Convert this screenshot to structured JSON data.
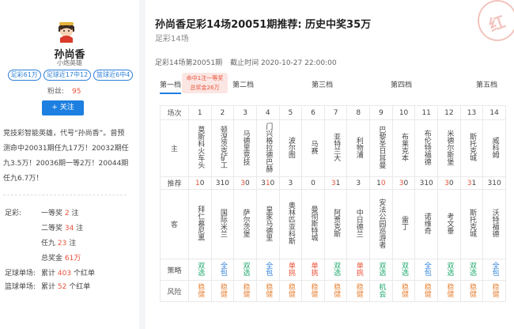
{
  "profile": {
    "name": "孙尚香",
    "title": "小炮英雄",
    "tags": [
      "足彩61万",
      "足球近17中12",
      "篮球近6中4"
    ],
    "fans_label": "粉丝:",
    "fans_count": "95",
    "follow_label": "+ 关注",
    "intro": "竞技彩智能英雄，代号“孙尚香”。曾预测命中20031期任九17万！20032期任九3.5万！20036期一等2万！20044期任九6.7万！",
    "stats": {
      "zucai_label": "足彩:",
      "first_label": "一等奖",
      "first_value": "2",
      "first_unit": "注",
      "second_label": "二等奖",
      "second_value": "34",
      "second_unit": "注",
      "renjiu_label": "任九",
      "renjiu_value": "23",
      "renjiu_unit": "注",
      "total_label": "总奖金",
      "total_value": "61万",
      "football_label": "足球单场:",
      "football_prefix": "累计",
      "football_value": "403",
      "football_suffix": "个红单",
      "basketball_label": "篮球单场:",
      "basketball_prefix": "累计",
      "basketball_value": "52",
      "basketball_suffix": "个红单"
    }
  },
  "main": {
    "title": "孙尚香足彩14场20051期推荐: 历史中奖35万",
    "subtitle": "足彩14场",
    "stamp": "红",
    "issue": "足彩14场第20051期",
    "deadline": "截止时间 2020-10-27 22:00:00",
    "tabs": [
      "第一档",
      "第二档",
      "第三档",
      "第四档",
      "第五档"
    ],
    "tab_badge_line1": "命中1注一等奖",
    "tab_badge_line2": "总奖金26万",
    "row_labels": {
      "match": "场次",
      "home": "主",
      "rec": "推荐",
      "away": "客",
      "strategy": "策略",
      "risk": "风险"
    },
    "matches": [
      {
        "n": "1",
        "home": "莫斯科火车头",
        "rec": "10",
        "rec_pick": "1",
        "away": "拜仁慕尼黑",
        "strategy": "双选",
        "strategy_color": "green",
        "risk": "稳健"
      },
      {
        "n": "2",
        "home": "顿涅茨克矿工",
        "rec": "310",
        "rec_pick": "310",
        "away": "国际米兰",
        "strategy": "全包",
        "strategy_color": "blue",
        "risk": "稳健"
      },
      {
        "n": "3",
        "home": "马德里竞技",
        "rec": "30",
        "rec_pick": "3",
        "away": "萨尔茨堡",
        "strategy": "双选",
        "strategy_color": "green",
        "risk": "稳健"
      },
      {
        "n": "4",
        "home": "门兴格拉德巴赫",
        "rec": "310",
        "rec_pick": "1",
        "away": "皇家马德里",
        "strategy": "全包",
        "strategy_color": "blue",
        "risk": "稳健"
      },
      {
        "n": "5",
        "home": "波尔图",
        "rec": "3",
        "rec_pick": "3",
        "away": "奥林匹亚科斯",
        "strategy": "单挑",
        "strategy_color": "red",
        "risk": "稳健"
      },
      {
        "n": "6",
        "home": "马赛",
        "rec": "0",
        "rec_pick": "0",
        "away": "曼彻斯特城",
        "strategy": "单挑",
        "strategy_color": "red",
        "risk": "稳健"
      },
      {
        "n": "7",
        "home": "亚特兰大",
        "rec": "31",
        "rec_pick": "3",
        "away": "阿贾克斯",
        "strategy": "双选",
        "strategy_color": "green",
        "risk": "稳健"
      },
      {
        "n": "8",
        "home": "利物浦",
        "rec": "3",
        "rec_pick": "3",
        "away": "中日德兰",
        "strategy": "单挑",
        "strategy_color": "red",
        "risk": "稳健"
      },
      {
        "n": "9",
        "home": "巴黎圣日耳曼",
        "rec": "10",
        "rec_pick": "0",
        "away": "安法公园巡游者",
        "strategy": "双选",
        "strategy_color": "green",
        "risk": "机会"
      },
      {
        "n": "10",
        "home": "布莱克本",
        "rec": "30",
        "rec_pick": "3",
        "away": "雷丁",
        "strategy": "双选",
        "strategy_color": "green",
        "risk": "稳健"
      },
      {
        "n": "11",
        "home": "布伦特福德",
        "rec": "310",
        "rec_pick": "310",
        "away": "诺维奇",
        "strategy": "全包",
        "strategy_color": "blue",
        "risk": "稳健"
      },
      {
        "n": "12",
        "home": "米德尔斯堡",
        "rec": "30",
        "rec_pick": "3",
        "away": "考文垂",
        "strategy": "双选",
        "strategy_color": "green",
        "risk": "稳健"
      },
      {
        "n": "13",
        "home": "斯托克城",
        "rec": "31",
        "rec_pick": "3",
        "away": "斯托克城",
        "strategy": "双选",
        "strategy_color": "green",
        "risk": "稳健"
      },
      {
        "n": "14",
        "home": "威科姆",
        "rec": "310",
        "rec_pick": "310",
        "away": "沃特福德",
        "strategy": "全包",
        "strategy_color": "blue",
        "risk": "稳健"
      }
    ]
  },
  "colors": {
    "accent": "#1d7fe0",
    "red": "#e8533a",
    "green": "#1aa86a",
    "orange": "#e8853a"
  }
}
